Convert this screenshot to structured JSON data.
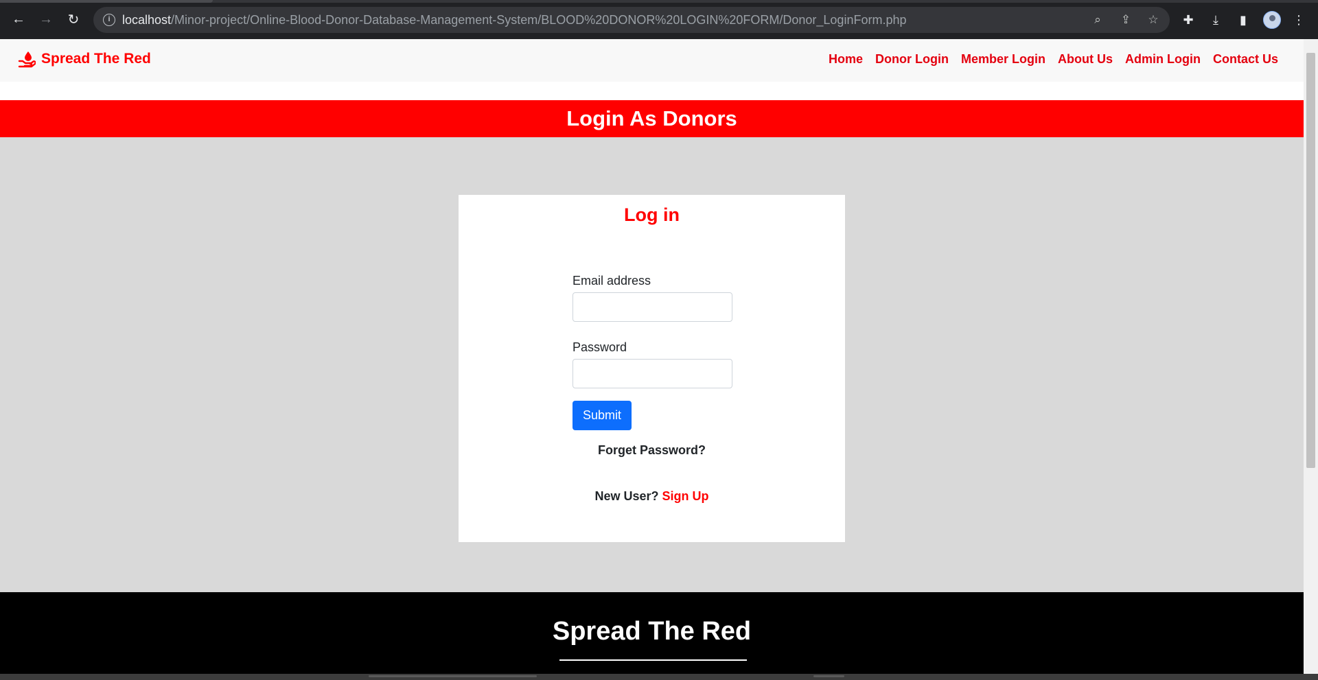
{
  "browser": {
    "url_host": "localhost",
    "url_path": "/Minor-project/Online-Blood-Donor-Database-Management-System/BLOOD%20DONOR%20LOGIN%20FORM/Donor_LoginForm.php"
  },
  "navbar": {
    "brand": "Spread The Red",
    "links": [
      "Home",
      "Donor Login",
      "Member Login",
      "About Us",
      "Admin Login",
      "Contact Us"
    ]
  },
  "banner": {
    "title": "Login As Donors"
  },
  "login": {
    "title": "Log in",
    "email_label": "Email address",
    "email_value": "",
    "password_label": "Password",
    "password_value": "",
    "submit_label": "Submit",
    "forget_label": "Forget Password?",
    "new_user_label": "New User?",
    "signup_label": "Sign Up"
  },
  "footer": {
    "title": "Spread The Red"
  },
  "colors": {
    "brand_red": "#ff0000",
    "submit_blue": "#0d6efd",
    "page_gray": "#d9d9d9",
    "footer_black": "#000000"
  }
}
